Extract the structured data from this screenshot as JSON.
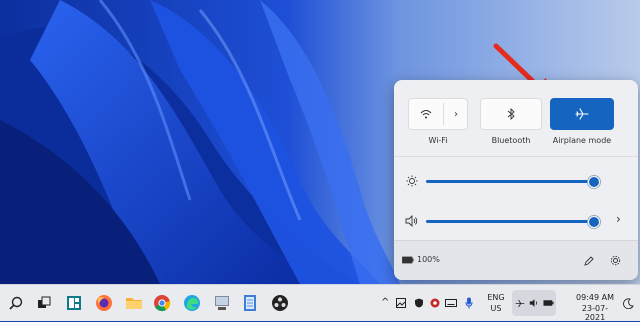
{
  "quick_settings": {
    "tiles": [
      {
        "id": "wifi",
        "label": "Wi-Fi",
        "active": false
      },
      {
        "id": "bluetooth",
        "label": "Bluetooth",
        "active": false
      },
      {
        "id": "airplane",
        "label": "Airplane mode",
        "active": true
      }
    ],
    "brightness": {
      "level": 0.97
    },
    "volume": {
      "level": 0.97
    },
    "battery_label": "100%"
  },
  "taskbar": {
    "language": {
      "line1": "ENG",
      "line2": "US"
    },
    "time": "09:49 AM",
    "date": "23-07-2021"
  },
  "colors": {
    "accent": "#1565c0",
    "annotation_arrow": "#e52b1e"
  }
}
